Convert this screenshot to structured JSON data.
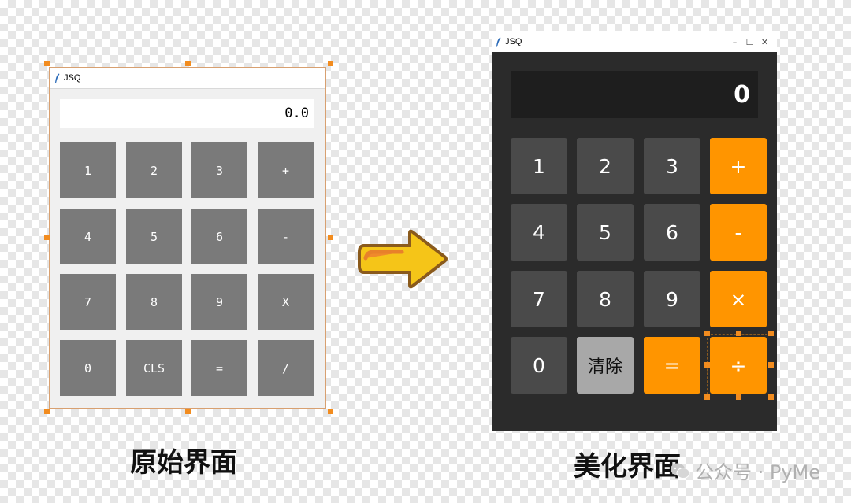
{
  "original": {
    "window_title": "JSQ",
    "display_value": "0.0",
    "buttons": [
      "1",
      "2",
      "3",
      "+",
      "4",
      "5",
      "6",
      "-",
      "7",
      "8",
      "9",
      "X",
      "0",
      "CLS",
      "=",
      "/"
    ],
    "caption": "原始界面"
  },
  "beautified": {
    "window_title": "JSQ",
    "window_controls": {
      "minimize": "–",
      "maximize": "☐",
      "close": "✕"
    },
    "display_value": "0",
    "buttons": [
      "1",
      "2",
      "3",
      "+",
      "4",
      "5",
      "6",
      "-",
      "7",
      "8",
      "9",
      "×",
      "0",
      "清除",
      "=",
      "÷"
    ],
    "caption": "美化界面"
  },
  "watermark": {
    "text": "公众号 · PyMe"
  },
  "icons": {
    "app_icon": "feather-icon",
    "arrow": "right-arrow-icon",
    "watermark_icon": "wechat-icon"
  },
  "colors": {
    "orig_button": "#7a7a7a",
    "new_background": "#2b2b2b",
    "new_display": "#1e1e1e",
    "new_number": "#4a4a4a",
    "new_operator": "#ff9500",
    "new_clear": "#a8a8a8",
    "selection_handle": "#f28c1f",
    "arrow_fill": "#f5c518",
    "arrow_outline": "#8a5a1c"
  }
}
